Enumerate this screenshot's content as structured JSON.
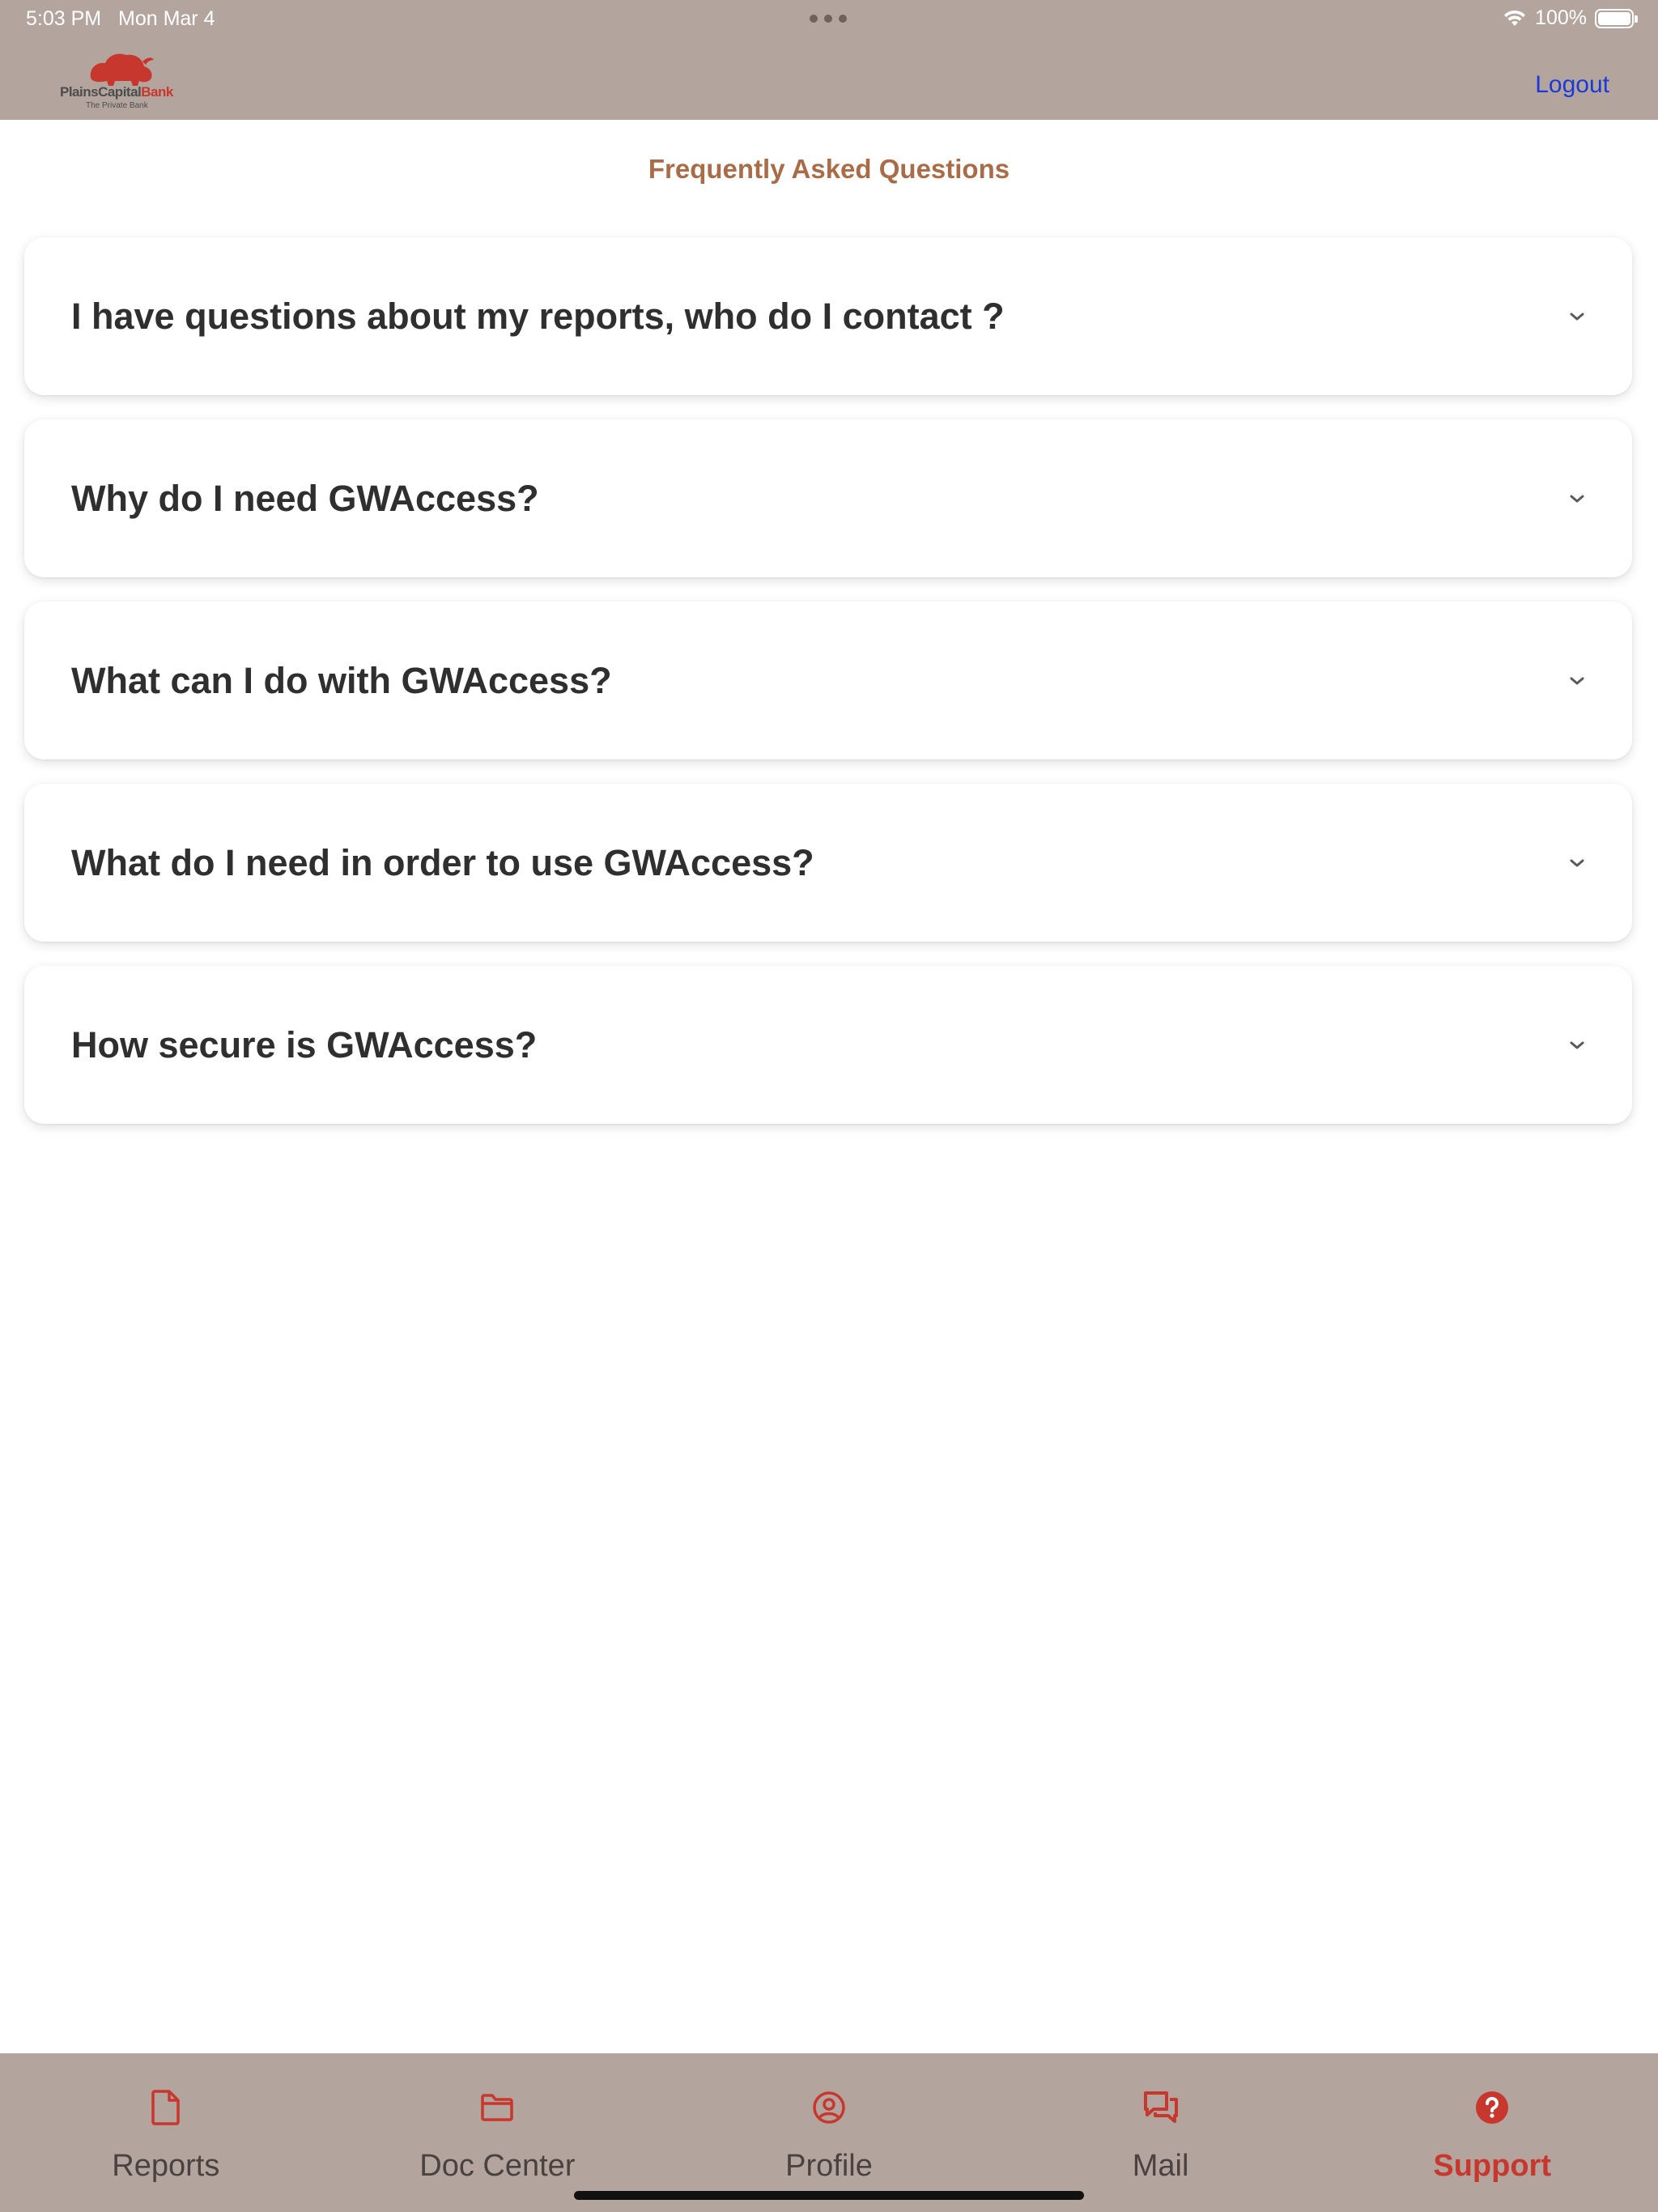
{
  "status_bar": {
    "time": "5:03 PM",
    "date": "Mon Mar 4",
    "battery": "100%"
  },
  "header": {
    "logo_name_part1": "PlainsCapital",
    "logo_name_part2": "Bank",
    "logo_subtitle": "The Private Bank",
    "logout_label": "Logout"
  },
  "page": {
    "title": "Frequently Asked Questions"
  },
  "faq": [
    {
      "question": "I have questions about my reports, who do I contact ?"
    },
    {
      "question": "Why do I need GWAccess?"
    },
    {
      "question": "What can I do with GWAccess?"
    },
    {
      "question": "What do I need in order to use GWAccess?"
    },
    {
      "question": "How secure is GWAccess?"
    }
  ],
  "tabs": [
    {
      "label": "Reports",
      "icon": "document-icon"
    },
    {
      "label": "Doc Center",
      "icon": "folder-icon"
    },
    {
      "label": "Profile",
      "icon": "user-circle-icon"
    },
    {
      "label": "Mail",
      "icon": "chat-bubbles-icon"
    },
    {
      "label": "Support",
      "icon": "question-circle-icon",
      "active": true
    }
  ],
  "colors": {
    "header_bg": "#b3a59d",
    "brand_red": "#c8372d",
    "title_brown": "#a86c48",
    "link_blue": "#1a39d6"
  }
}
